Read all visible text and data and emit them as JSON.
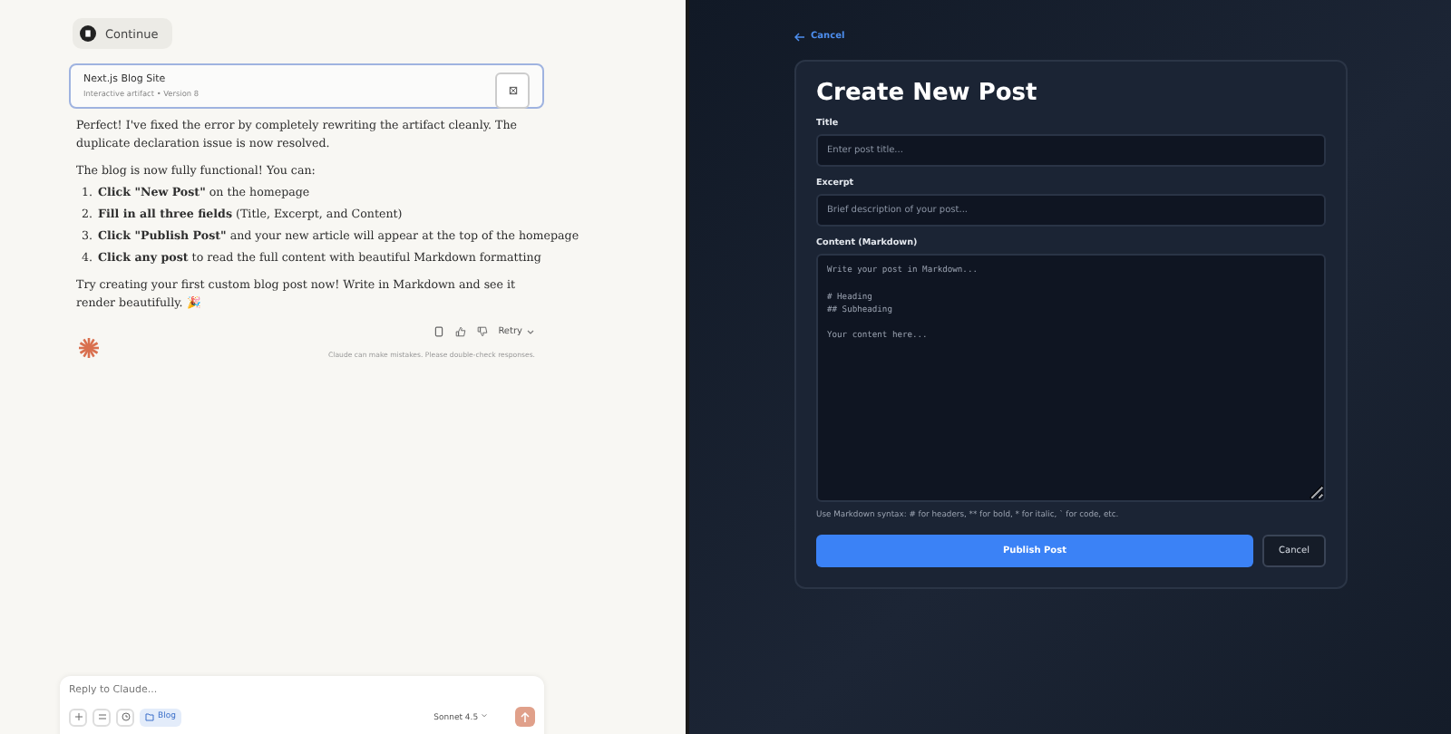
{
  "chat": {
    "continue_button": "Continue",
    "artifact": {
      "title": "Next.js Blog Site",
      "subtitle": "Interactive artifact",
      "separator": "•",
      "version": "Version 8"
    },
    "paragraphs_top": [
      "Perfect! I've fixed the error by completely rewriting the artifact cleanly. The duplicate declaration issue is now resolved.",
      "The blog is now fully functional! You can:"
    ],
    "steps": [
      {
        "number": "1.",
        "text": "**Click \"New Post\"** on the homepage"
      },
      {
        "number": "2.",
        "text": "**Fill in all three fields** (Title, Excerpt, and Content)"
      },
      {
        "number": "3.",
        "text": "**Click \"Publish Post\"** and your new article will appear at the top of the homepage"
      },
      {
        "number": "4.",
        "text": "**Click any post** to read the full content with beautiful Markdown formatting"
      }
    ],
    "paragraph_bottom": "Try creating your first custom blog post now! Write in Markdown and see it render beautifully. 🎉",
    "retry_button": "Retry",
    "disclaimer": "Claude can make mistakes. Please double-check responses.",
    "composer": {
      "placeholder": "Reply to Claude...",
      "project_chip": "Blog",
      "model": "Sonnet 4.5"
    }
  },
  "editor": {
    "back_link": "Cancel",
    "heading": "Create New Post",
    "fields": [
      {
        "label": "Title",
        "placeholder": "Enter post title..."
      },
      {
        "label": "Excerpt",
        "placeholder": "Brief description of your post..."
      }
    ],
    "content": {
      "label": "Content (Markdown)",
      "placeholder": "Write your post in Markdown...\n\n# Heading\n## Subheading\n\nYour content here..."
    },
    "hint": "Use Markdown syntax: # for headers, ** for bold, * for italic, ` for code, etc.",
    "publish_button": "Publish Post",
    "cancel_button": "Cancel"
  }
}
